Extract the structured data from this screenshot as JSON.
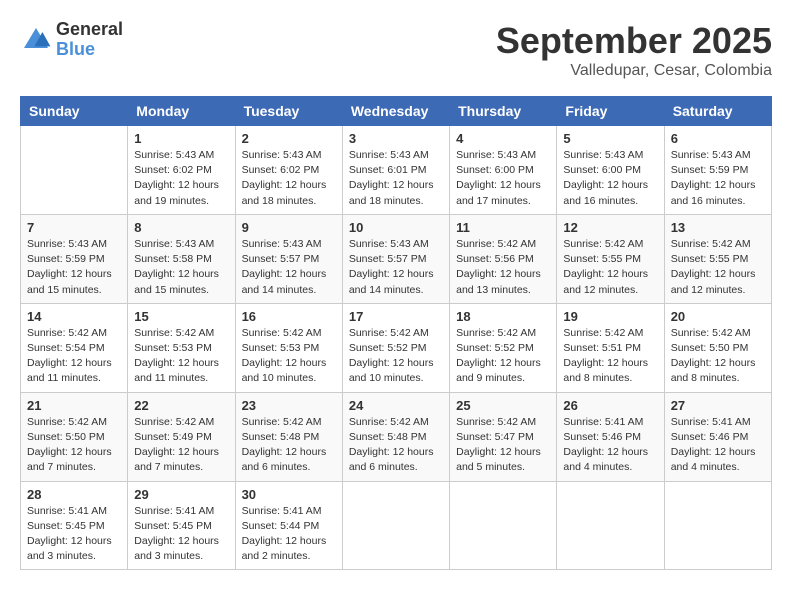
{
  "header": {
    "logo_line1": "General",
    "logo_line2": "Blue",
    "month_title": "September 2025",
    "location": "Valledupar, Cesar, Colombia"
  },
  "days_of_week": [
    "Sunday",
    "Monday",
    "Tuesday",
    "Wednesday",
    "Thursday",
    "Friday",
    "Saturday"
  ],
  "weeks": [
    [
      {
        "day": "",
        "info": ""
      },
      {
        "day": "1",
        "info": "Sunrise: 5:43 AM\nSunset: 6:02 PM\nDaylight: 12 hours\nand 19 minutes."
      },
      {
        "day": "2",
        "info": "Sunrise: 5:43 AM\nSunset: 6:02 PM\nDaylight: 12 hours\nand 18 minutes."
      },
      {
        "day": "3",
        "info": "Sunrise: 5:43 AM\nSunset: 6:01 PM\nDaylight: 12 hours\nand 18 minutes."
      },
      {
        "day": "4",
        "info": "Sunrise: 5:43 AM\nSunset: 6:00 PM\nDaylight: 12 hours\nand 17 minutes."
      },
      {
        "day": "5",
        "info": "Sunrise: 5:43 AM\nSunset: 6:00 PM\nDaylight: 12 hours\nand 16 minutes."
      },
      {
        "day": "6",
        "info": "Sunrise: 5:43 AM\nSunset: 5:59 PM\nDaylight: 12 hours\nand 16 minutes."
      }
    ],
    [
      {
        "day": "7",
        "info": "Sunrise: 5:43 AM\nSunset: 5:59 PM\nDaylight: 12 hours\nand 15 minutes."
      },
      {
        "day": "8",
        "info": "Sunrise: 5:43 AM\nSunset: 5:58 PM\nDaylight: 12 hours\nand 15 minutes."
      },
      {
        "day": "9",
        "info": "Sunrise: 5:43 AM\nSunset: 5:57 PM\nDaylight: 12 hours\nand 14 minutes."
      },
      {
        "day": "10",
        "info": "Sunrise: 5:43 AM\nSunset: 5:57 PM\nDaylight: 12 hours\nand 14 minutes."
      },
      {
        "day": "11",
        "info": "Sunrise: 5:42 AM\nSunset: 5:56 PM\nDaylight: 12 hours\nand 13 minutes."
      },
      {
        "day": "12",
        "info": "Sunrise: 5:42 AM\nSunset: 5:55 PM\nDaylight: 12 hours\nand 12 minutes."
      },
      {
        "day": "13",
        "info": "Sunrise: 5:42 AM\nSunset: 5:55 PM\nDaylight: 12 hours\nand 12 minutes."
      }
    ],
    [
      {
        "day": "14",
        "info": "Sunrise: 5:42 AM\nSunset: 5:54 PM\nDaylight: 12 hours\nand 11 minutes."
      },
      {
        "day": "15",
        "info": "Sunrise: 5:42 AM\nSunset: 5:53 PM\nDaylight: 12 hours\nand 11 minutes."
      },
      {
        "day": "16",
        "info": "Sunrise: 5:42 AM\nSunset: 5:53 PM\nDaylight: 12 hours\nand 10 minutes."
      },
      {
        "day": "17",
        "info": "Sunrise: 5:42 AM\nSunset: 5:52 PM\nDaylight: 12 hours\nand 10 minutes."
      },
      {
        "day": "18",
        "info": "Sunrise: 5:42 AM\nSunset: 5:52 PM\nDaylight: 12 hours\nand 9 minutes."
      },
      {
        "day": "19",
        "info": "Sunrise: 5:42 AM\nSunset: 5:51 PM\nDaylight: 12 hours\nand 8 minutes."
      },
      {
        "day": "20",
        "info": "Sunrise: 5:42 AM\nSunset: 5:50 PM\nDaylight: 12 hours\nand 8 minutes."
      }
    ],
    [
      {
        "day": "21",
        "info": "Sunrise: 5:42 AM\nSunset: 5:50 PM\nDaylight: 12 hours\nand 7 minutes."
      },
      {
        "day": "22",
        "info": "Sunrise: 5:42 AM\nSunset: 5:49 PM\nDaylight: 12 hours\nand 7 minutes."
      },
      {
        "day": "23",
        "info": "Sunrise: 5:42 AM\nSunset: 5:48 PM\nDaylight: 12 hours\nand 6 minutes."
      },
      {
        "day": "24",
        "info": "Sunrise: 5:42 AM\nSunset: 5:48 PM\nDaylight: 12 hours\nand 6 minutes."
      },
      {
        "day": "25",
        "info": "Sunrise: 5:42 AM\nSunset: 5:47 PM\nDaylight: 12 hours\nand 5 minutes."
      },
      {
        "day": "26",
        "info": "Sunrise: 5:41 AM\nSunset: 5:46 PM\nDaylight: 12 hours\nand 4 minutes."
      },
      {
        "day": "27",
        "info": "Sunrise: 5:41 AM\nSunset: 5:46 PM\nDaylight: 12 hours\nand 4 minutes."
      }
    ],
    [
      {
        "day": "28",
        "info": "Sunrise: 5:41 AM\nSunset: 5:45 PM\nDaylight: 12 hours\nand 3 minutes."
      },
      {
        "day": "29",
        "info": "Sunrise: 5:41 AM\nSunset: 5:45 PM\nDaylight: 12 hours\nand 3 minutes."
      },
      {
        "day": "30",
        "info": "Sunrise: 5:41 AM\nSunset: 5:44 PM\nDaylight: 12 hours\nand 2 minutes."
      },
      {
        "day": "",
        "info": ""
      },
      {
        "day": "",
        "info": ""
      },
      {
        "day": "",
        "info": ""
      },
      {
        "day": "",
        "info": ""
      }
    ]
  ]
}
